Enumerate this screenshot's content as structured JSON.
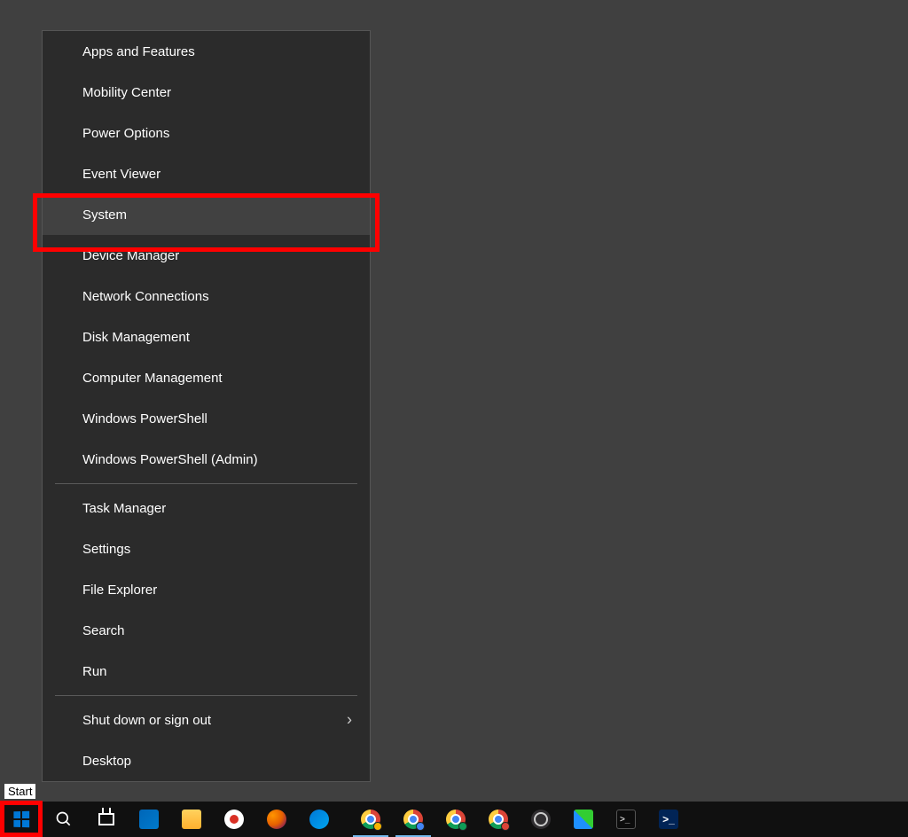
{
  "tooltip": "Start",
  "menu": {
    "group1": [
      "Apps and Features",
      "Mobility Center",
      "Power Options",
      "Event Viewer",
      "System",
      "Device Manager",
      "Network Connections",
      "Disk Management",
      "Computer Management",
      "Windows PowerShell",
      "Windows PowerShell (Admin)"
    ],
    "group2": [
      "Task Manager",
      "Settings",
      "File Explorer",
      "Search",
      "Run"
    ],
    "group3": [
      {
        "label": "Shut down or sign out",
        "submenu": true
      },
      {
        "label": "Desktop",
        "submenu": false
      }
    ]
  },
  "hovered_item": "System",
  "highlights": {
    "menu_item": "System",
    "start_button": true
  },
  "taskbar": {
    "items": [
      {
        "name": "start",
        "type": "start"
      },
      {
        "name": "search",
        "type": "search"
      },
      {
        "name": "task-view",
        "type": "taskview"
      },
      {
        "name": "vscode",
        "type": "app",
        "cls": "vscode"
      },
      {
        "name": "file-explorer",
        "type": "app",
        "cls": "explorer"
      },
      {
        "name": "snagit",
        "type": "app",
        "cls": "snagit"
      },
      {
        "name": "firefox",
        "type": "app",
        "cls": "firefox"
      },
      {
        "name": "edge",
        "type": "app",
        "cls": "edge"
      },
      {
        "name": "gap",
        "type": "gap"
      },
      {
        "name": "chrome-1",
        "type": "chrome",
        "badge": "#f5b400",
        "active": true
      },
      {
        "name": "chrome-2",
        "type": "chrome",
        "badge": "#4285f4",
        "active": true
      },
      {
        "name": "chrome-3",
        "type": "chrome",
        "badge": "#0f9d58"
      },
      {
        "name": "chrome-4",
        "type": "chrome",
        "badge": "#db4437"
      },
      {
        "name": "obs",
        "type": "app",
        "cls": "obs"
      },
      {
        "name": "winscp",
        "type": "app",
        "cls": "winscp"
      },
      {
        "name": "cmd",
        "type": "cmd"
      },
      {
        "name": "powershell",
        "type": "powershell"
      }
    ]
  }
}
